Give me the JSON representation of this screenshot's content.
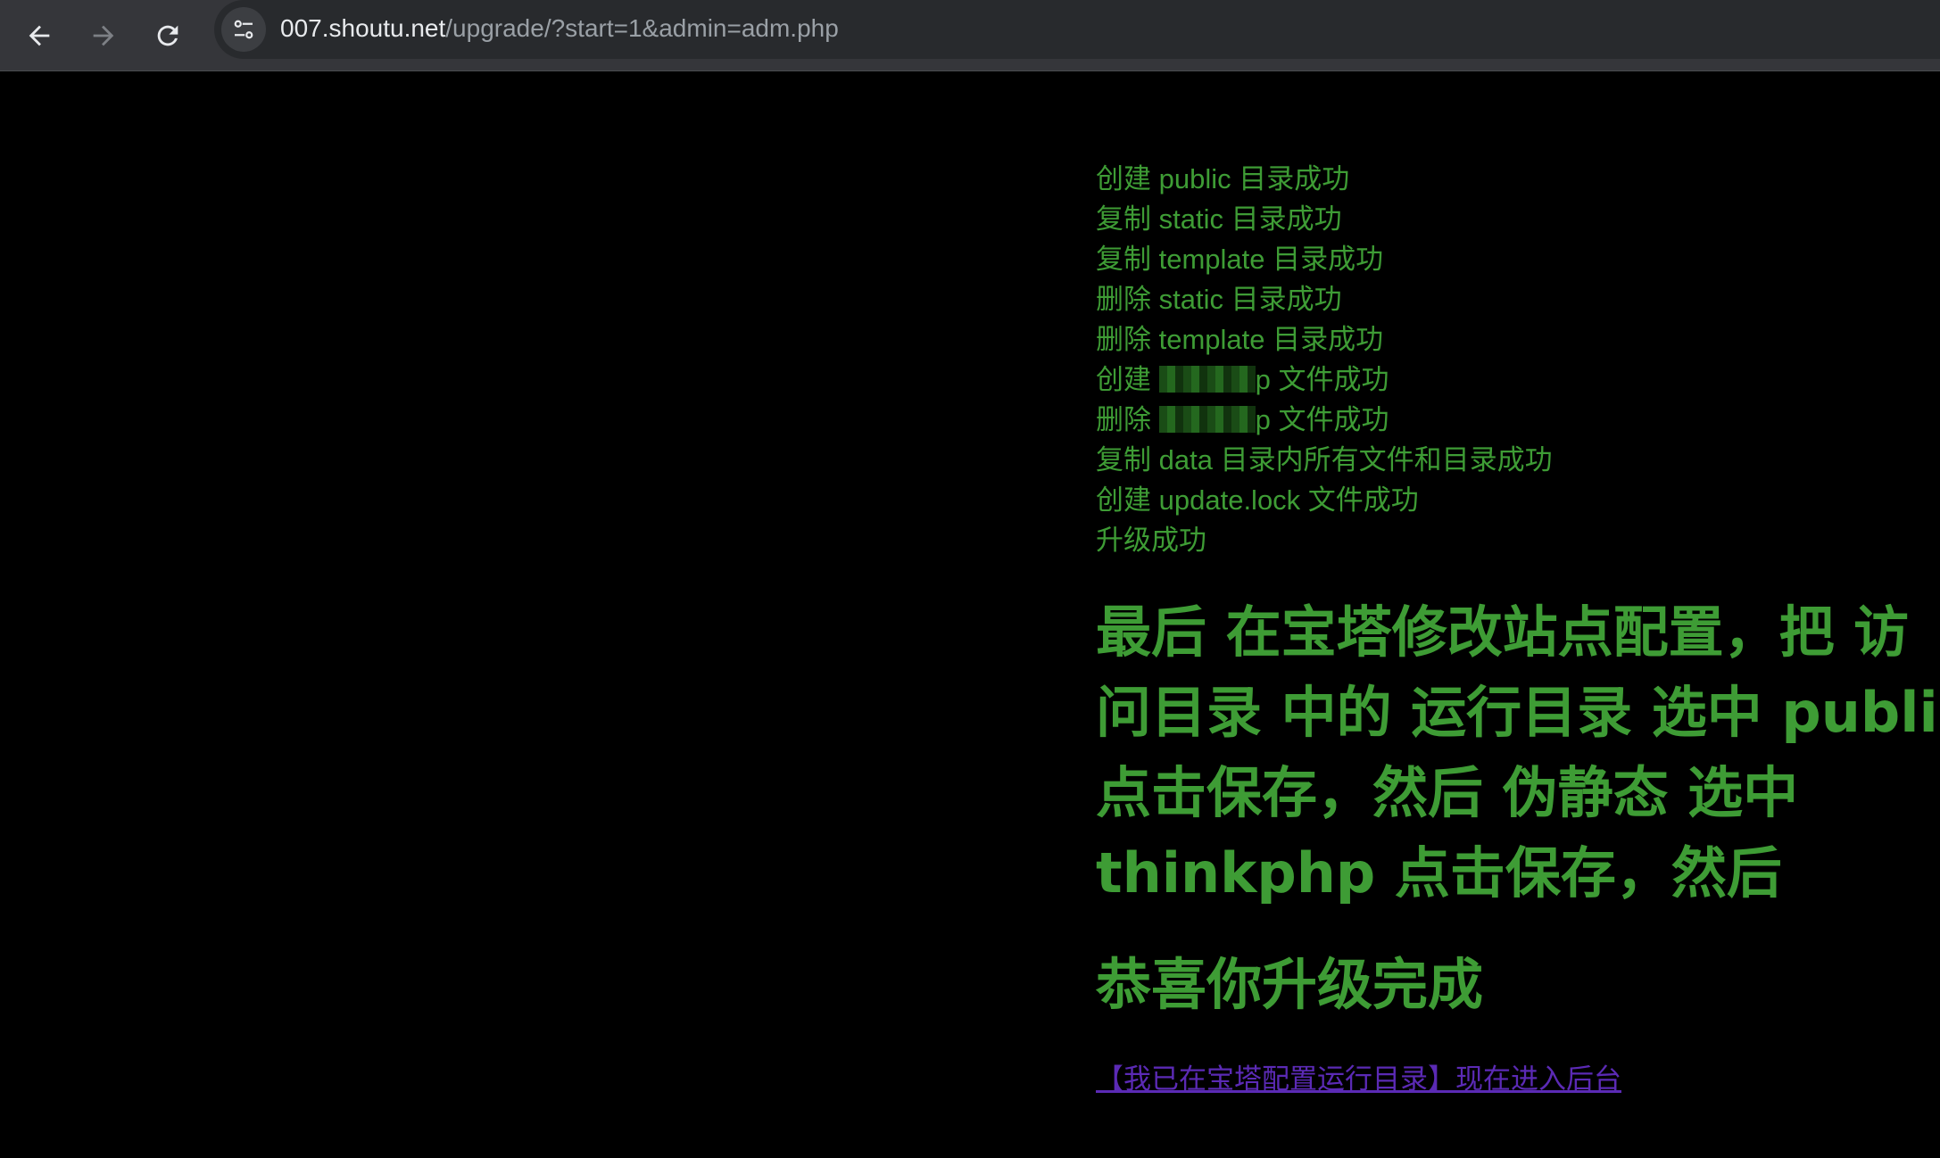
{
  "browser": {
    "url_host": "007.shoutu.net",
    "url_path": "/upgrade/?start=1&admin=adm.php"
  },
  "log": [
    {
      "pre": "创建 ",
      "obj": "public",
      "post": " 目录成功"
    },
    {
      "pre": "复制 ",
      "obj": "static",
      "post": " 目录成功"
    },
    {
      "pre": "复制 ",
      "obj": "template",
      "post": " 目录成功"
    },
    {
      "pre": "删除 ",
      "obj": "static",
      "post": " 目录成功"
    },
    {
      "pre": "删除 ",
      "obj": "template",
      "post": " 目录成功"
    },
    {
      "pre": "创建 ",
      "obj": "p",
      "post": " 文件成功",
      "redacted": true
    },
    {
      "pre": "删除 ",
      "obj": "p",
      "post": " 文件成功",
      "redacted": true
    },
    {
      "pre": "复制 ",
      "obj": "data",
      "post": " 目录内所有文件和目录成功"
    },
    {
      "pre": "创建 ",
      "obj": "update.lock",
      "post": " 文件成功"
    },
    {
      "pre": "升级成功",
      "obj": "",
      "post": ""
    }
  ],
  "instructions": [
    "最后 在宝塔修改站点配置，把 访",
    "问目录 中的 运行目录 选中 public",
    "点击保存，然后 伪静态 选中",
    "thinkphp 点击保存，然后"
  ],
  "congrats": "恭喜你升级完成",
  "admin_link": "【我已在宝塔配置运行目录】现在进入后台",
  "colors": {
    "text_green": "#3e9c35",
    "link_purple": "#5b2ab5",
    "background": "#000000",
    "toolbar": "#35363a"
  }
}
